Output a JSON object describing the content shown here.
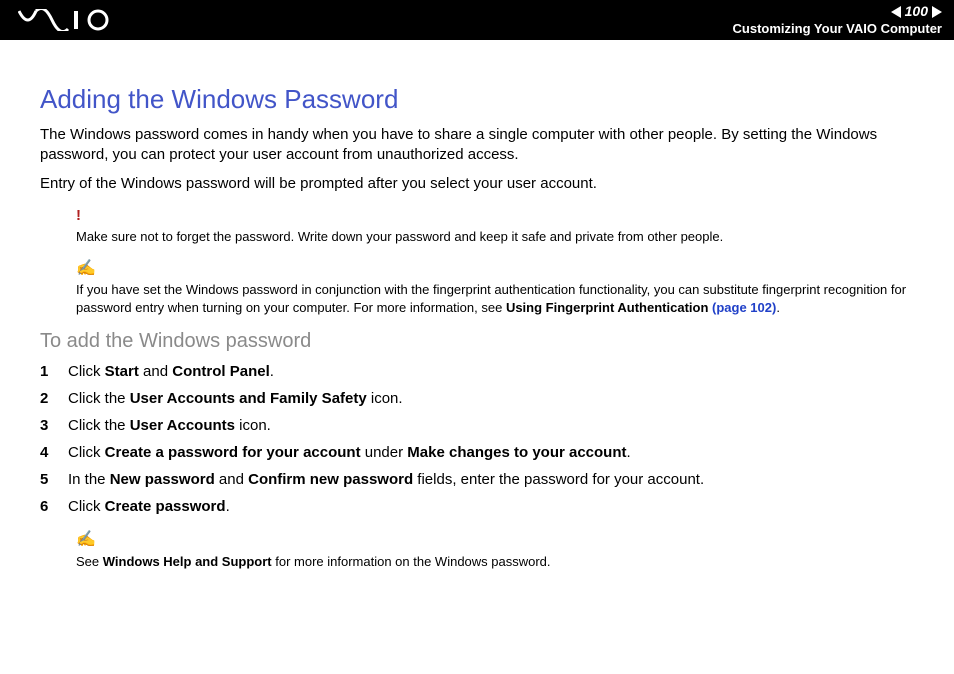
{
  "header": {
    "page_number": "100",
    "breadcrumb": "Customizing Your VAIO Computer"
  },
  "title": "Adding the Windows Password",
  "intro": [
    "The Windows password comes in handy when you have to share a single computer with other people. By setting the Windows password, you can protect your user account from unauthorized access.",
    "Entry of the Windows password will be prompted after you select your user account."
  ],
  "caution": {
    "text": "Make sure not to forget the password. Write down your password and keep it safe and private from other people."
  },
  "tip1": {
    "pre": "If you have set the Windows password in conjunction with the fingerprint authentication functionality, you can substitute fingerprint recognition for password entry when turning on your computer. For more information, see ",
    "bold": "Using Fingerprint Authentication ",
    "link": "(page 102)",
    "post": "."
  },
  "subheading": "To add the Windows password",
  "steps": [
    {
      "pre": "Click ",
      "b1": "Start",
      "mid": " and ",
      "b2": "Control Panel",
      "post": "."
    },
    {
      "pre": "Click the ",
      "b1": "User Accounts and Family Safety",
      "post": " icon."
    },
    {
      "pre": "Click the ",
      "b1": "User Accounts",
      "post": " icon."
    },
    {
      "pre": "Click ",
      "b1": "Create a password for your account",
      "mid": " under ",
      "b2": "Make changes to your account",
      "post": "."
    },
    {
      "pre": "In the ",
      "b1": "New password",
      "mid": " and ",
      "b2": "Confirm new password",
      "post": " fields, enter the password for your account."
    },
    {
      "pre": "Click ",
      "b1": "Create password",
      "post": "."
    }
  ],
  "tip2": {
    "pre": "See ",
    "bold": "Windows Help and Support",
    "post": " for more information on the Windows password."
  }
}
